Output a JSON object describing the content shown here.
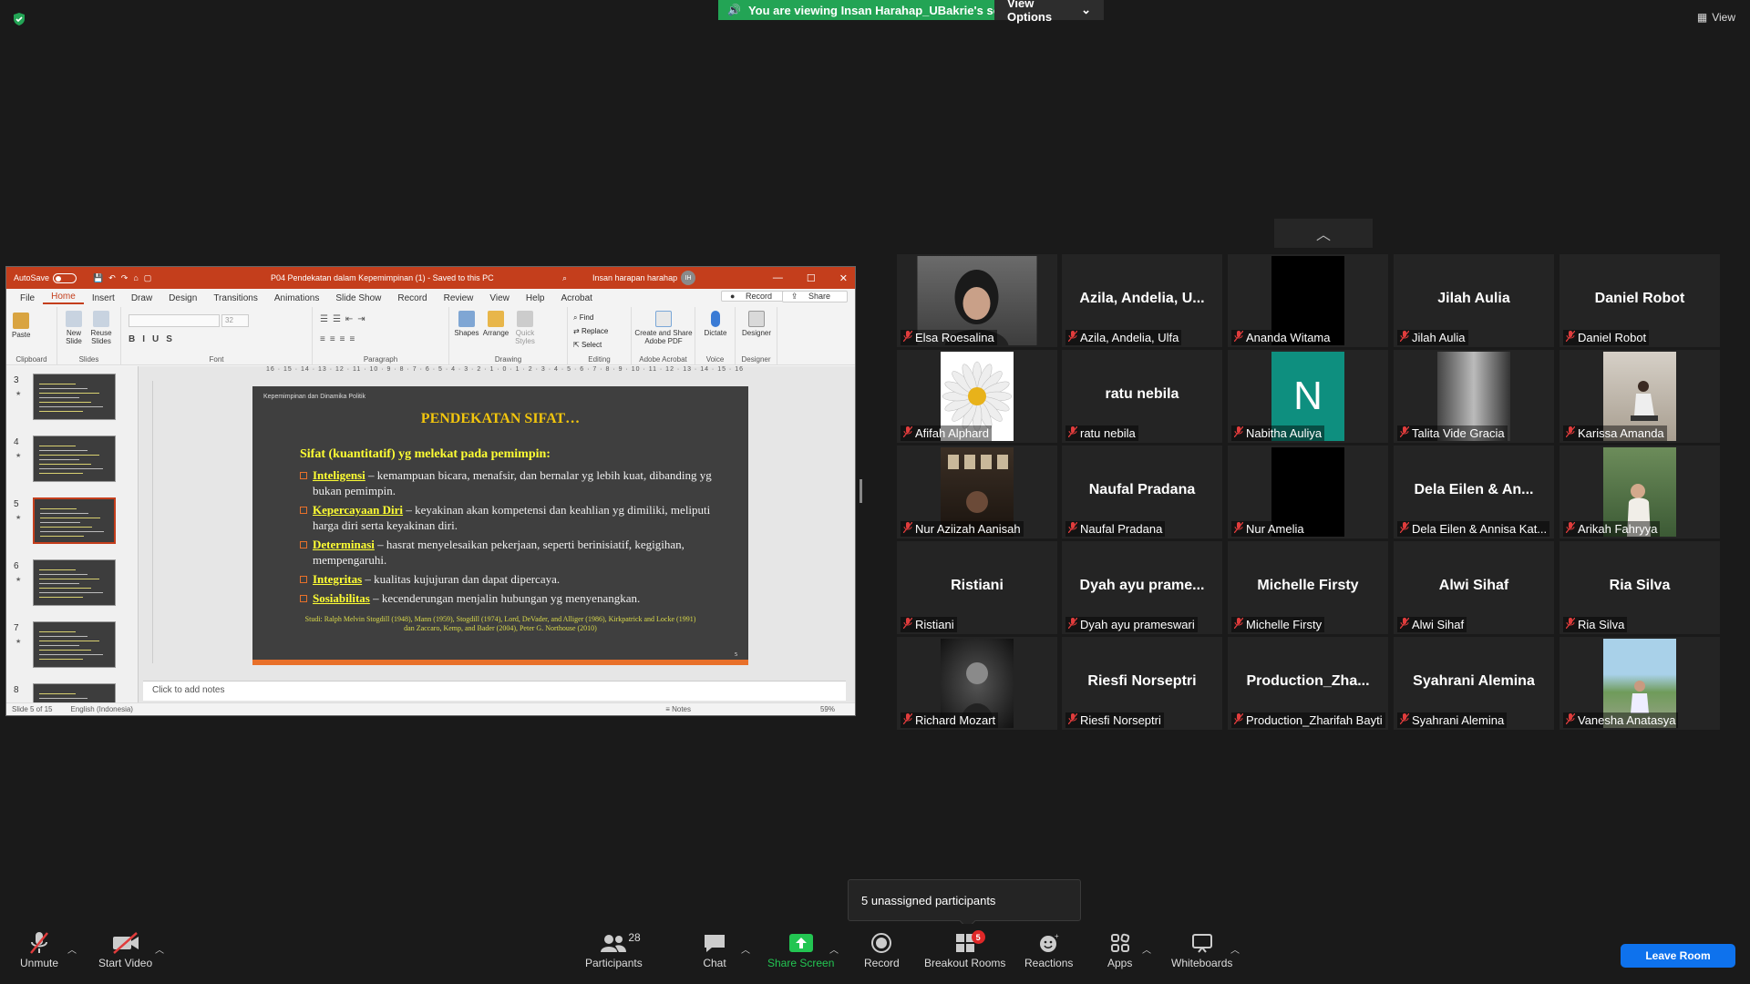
{
  "meeting": {
    "viewing_banner": "You are viewing Insan Harahap_UBakrie's screen",
    "view_options": "View Options",
    "view_label": "View",
    "unassigned_popup": "5 unassigned participants"
  },
  "ppt": {
    "autosave": "AutoSave",
    "autosave_state": "Off",
    "doc_title": "P04 Pendekatan dalam Kepemimpinan (1) - Saved to this PC",
    "user": "Insan harapan harahap",
    "user_initials": "IH",
    "tabs": [
      "File",
      "Home",
      "Insert",
      "Draw",
      "Design",
      "Transitions",
      "Animations",
      "Slide Show",
      "Record",
      "Review",
      "View",
      "Help",
      "Acrobat"
    ],
    "record_btn": "Record",
    "share_btn": "Share",
    "ribbon": {
      "paste": "Paste",
      "new_slide": "New Slide",
      "reuse_slides": "Reuse Slides",
      "font_size": "32",
      "shapes": "Shapes",
      "arrange": "Arrange",
      "quick_styles": "Quick Styles",
      "find": "Find",
      "replace": "Replace",
      "select": "Select",
      "create_share_pdf": "Create and Share Adobe PDF",
      "dictate": "Dictate",
      "designer": "Designer",
      "groups": [
        "Clipboard",
        "Slides",
        "Font",
        "Paragraph",
        "Drawing",
        "Editing",
        "Adobe Acrobat",
        "Voice",
        "Designer"
      ]
    },
    "ruler": "16 · 15 · 14 · 13 · 12 · 11 · 10 · 9 · 8 · 7 · 6 · 5 · 4 · 3 · 2 · 1 · 0 · 1 · 2 · 3 · 4 · 5 · 6 · 7 · 8 · 9 · 10 · 11 · 12 · 13 · 14 · 15 · 16",
    "thumbnails": [
      {
        "num": "3",
        "star": "★"
      },
      {
        "num": "4",
        "star": "★"
      },
      {
        "num": "5",
        "star": "★"
      },
      {
        "num": "6",
        "star": "★"
      },
      {
        "num": "7",
        "star": "★"
      },
      {
        "num": "8",
        "star": ""
      }
    ],
    "slide": {
      "header": "Kepemimpinan dan Dinamika Politik",
      "title": "PENDEKATAN  SIFAT…",
      "subtitle": "Sifat  (kuantitatif) yg melekat pada pemimpin:",
      "items": [
        {
          "term": "Inteligensi",
          "text": " – kemampuan bicara, menafsir, dan bernalar  yg lebih kuat, dibanding yg bukan pemimpin."
        },
        {
          "term": "Kepercayaan Diri",
          "text": " – keyakinan akan kompetensi dan keahlian yg dimiliki, meliputi harga diri serta keyakinan diri."
        },
        {
          "term": "Determinasi",
          "text": " – hasrat menyelesaikan pekerjaan, seperti berinisiatif, kegigihan, mempengaruhi."
        },
        {
          "term": "Integritas",
          "text": " – kualitas kujujuran dan dapat dipercaya."
        },
        {
          "term": "Sosiabilitas",
          "text": " – kecenderungan menjalin hubungan yg menyenangkan."
        }
      ],
      "study": "Studi: Ralph Melvin Stogdill (1948), Mann (1959), Stogdill (1974), Lord, DeVader, and Alliger (1986), Kirkpatrick and Locke (1991) dan Zaccaro, Kemp, and Bader (2004), Peter G. Northouse (2010)",
      "page": "5"
    },
    "notes_placeholder": "Click to add notes",
    "status": {
      "slide": "Slide 5 of 15",
      "language": "English (Indonesia)",
      "notes": "Notes",
      "zoom": "59%"
    }
  },
  "participants_tiles": [
    {
      "big": "",
      "label": "Elsa Roesalina",
      "video": "photo-girl"
    },
    {
      "big": "Azila, Andelia, U...",
      "label": "Azila, Andelia, Ulfa",
      "video": ""
    },
    {
      "big": "",
      "label": "Ananda Witama",
      "video": "black"
    },
    {
      "big": "Jilah Aulia",
      "label": "Jilah Aulia",
      "video": ""
    },
    {
      "big": "Daniel Robot",
      "label": "Daniel Robot",
      "video": ""
    },
    {
      "big": "",
      "label": "Afifah Alphard",
      "video": "daisy"
    },
    {
      "big": "ratu nebila",
      "label": "ratu nebila",
      "video": ""
    },
    {
      "big": "",
      "label": "Nabitha Auliya",
      "video": "letter-N"
    },
    {
      "big": "",
      "label": "Talita Vide Gracia",
      "video": "photo-bw"
    },
    {
      "big": "",
      "label": "Karissa Amanda",
      "video": "photo-sitting"
    },
    {
      "big": "",
      "label": "Nur Aziizah Aanisah",
      "video": "photo-dark"
    },
    {
      "big": "Naufal Pradana",
      "label": "Naufal Pradana",
      "video": ""
    },
    {
      "big": "",
      "label": "Nur Amelia",
      "video": "black"
    },
    {
      "big": "Dela Eilen & An...",
      "label": "Dela Eilen & Annisa Kat...",
      "video": ""
    },
    {
      "big": "",
      "label": "Arikah Fahryya",
      "video": "photo-forest"
    },
    {
      "big": "Ristiani",
      "label": "Ristiani",
      "video": ""
    },
    {
      "big": "Dyah ayu prame...",
      "label": "Dyah ayu prameswari",
      "video": ""
    },
    {
      "big": "Michelle Firsty",
      "label": "Michelle Firsty",
      "video": ""
    },
    {
      "big": "Alwi Sihaf",
      "label": "Alwi Sihaf",
      "video": ""
    },
    {
      "big": "Ria Silva",
      "label": "Ria Silva",
      "video": ""
    },
    {
      "big": "",
      "label": "Richard Mozart",
      "video": "photo-bwman"
    },
    {
      "big": "Riesfi Norseptri",
      "label": "Riesfi Norseptri",
      "video": ""
    },
    {
      "big": "Production_Zha...",
      "label": "Production_Zharifah Bayti",
      "video": ""
    },
    {
      "big": "Syahrani Alemina",
      "label": "Syahrani Alemina",
      "video": ""
    },
    {
      "big": "",
      "label": "Vanesha Anatasya",
      "video": "photo-outdoor"
    }
  ],
  "toolbar": {
    "unmute": "Unmute",
    "start_video": "Start Video",
    "participants": "Participants",
    "participants_count": "28",
    "chat": "Chat",
    "share_screen": "Share Screen",
    "record": "Record",
    "breakout_rooms": "Breakout Rooms",
    "breakout_badge": "5",
    "reactions": "Reactions",
    "apps": "Apps",
    "whiteboards": "Whiteboards",
    "leave": "Leave Room"
  },
  "colors": {
    "background": "#1a1a1a",
    "tile": "#242424",
    "zoom_green": "#23a455",
    "leave_blue": "#0e72ed",
    "ppt_red": "#c43e1c",
    "mic_muted": "#e03c3c"
  }
}
